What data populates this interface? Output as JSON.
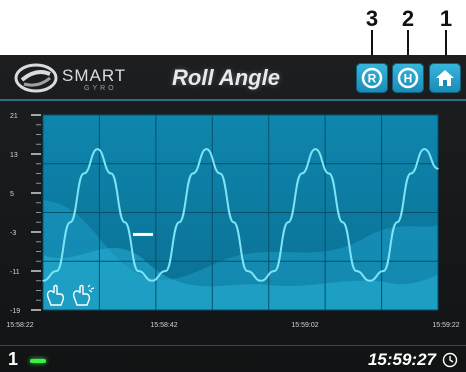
{
  "callouts": [
    "3",
    "2",
    "1"
  ],
  "header": {
    "logo_text": "SMART",
    "logo_sub": "GYRO",
    "title": "Roll Angle",
    "buttons": [
      {
        "label": "R",
        "icon": "r-circle-icon"
      },
      {
        "label": "H",
        "icon": "h-circle-icon"
      },
      {
        "label": "",
        "icon": "home-icon"
      }
    ]
  },
  "chart_data": {
    "type": "line",
    "title": "Roll Angle",
    "y_ticks": [
      21,
      13,
      5,
      -3,
      -11,
      -19
    ],
    "ylim": [
      -19,
      21
    ],
    "x_ticks": [
      "15:58:22",
      "15:58:42",
      "15:59:02",
      "15:59:22"
    ],
    "grid": true,
    "series": [
      {
        "values": [
          -13,
          -11,
          -1,
          9,
          14,
          9,
          -1,
          -11,
          -13,
          -11,
          -1,
          9,
          14,
          9,
          -1,
          -11,
          -13,
          -11,
          -1,
          9,
          14,
          9,
          -1,
          -11,
          -13,
          -11,
          -1,
          9,
          14,
          10
        ],
        "color": "#7fe3f8"
      }
    ],
    "current_marker": -3.5
  },
  "footer": {
    "page": "1",
    "time": "15:59:27"
  },
  "colors": {
    "accent": "#29a6d2",
    "plot_bg": "#0e7fa6",
    "line": "#7fe3f8",
    "status_led": "#3cf04a"
  }
}
